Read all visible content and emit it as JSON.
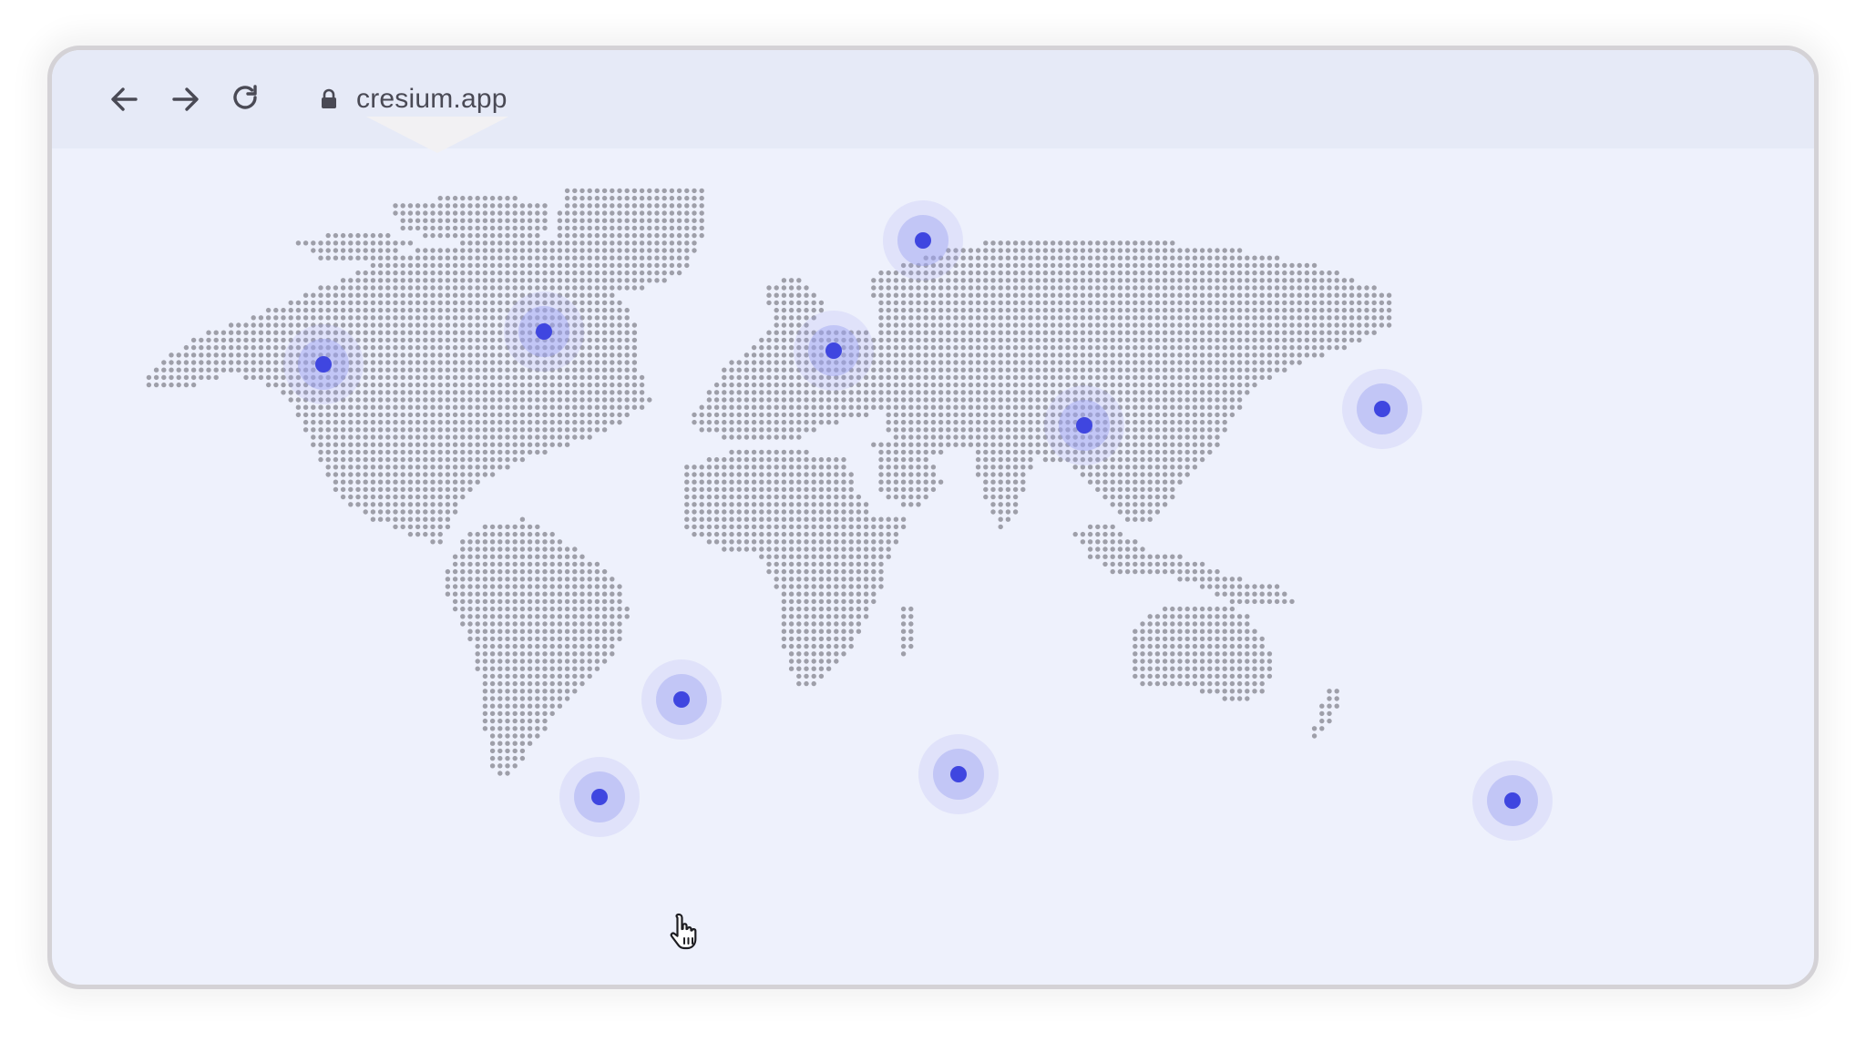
{
  "browser": {
    "url": "cresium.app",
    "nav_icons": [
      "back-arrow-icon",
      "forward-arrow-icon",
      "reload-icon",
      "lock-icon"
    ]
  },
  "colors": {
    "page_background": "#ffffff",
    "window_background": "#eef1fc",
    "toolbar_background": "#e6eaf7",
    "land_dot": "#9e9fa9",
    "marker": "#3f46e0",
    "marker_halo": "#9ea3f2"
  },
  "map": {
    "style": "dotted-world-map",
    "markers": [
      {
        "name": "marker-los-angeles"
      },
      {
        "name": "marker-new-york"
      },
      {
        "name": "marker-madrid"
      },
      {
        "name": "marker-stockholm"
      },
      {
        "name": "marker-dubai"
      },
      {
        "name": "marker-shanghai"
      },
      {
        "name": "marker-sao-paulo"
      },
      {
        "name": "marker-buenos-aires"
      },
      {
        "name": "marker-cape-town"
      },
      {
        "name": "marker-melbourne"
      }
    ]
  },
  "pointer": {
    "icon": "hand-pointer-icon"
  }
}
